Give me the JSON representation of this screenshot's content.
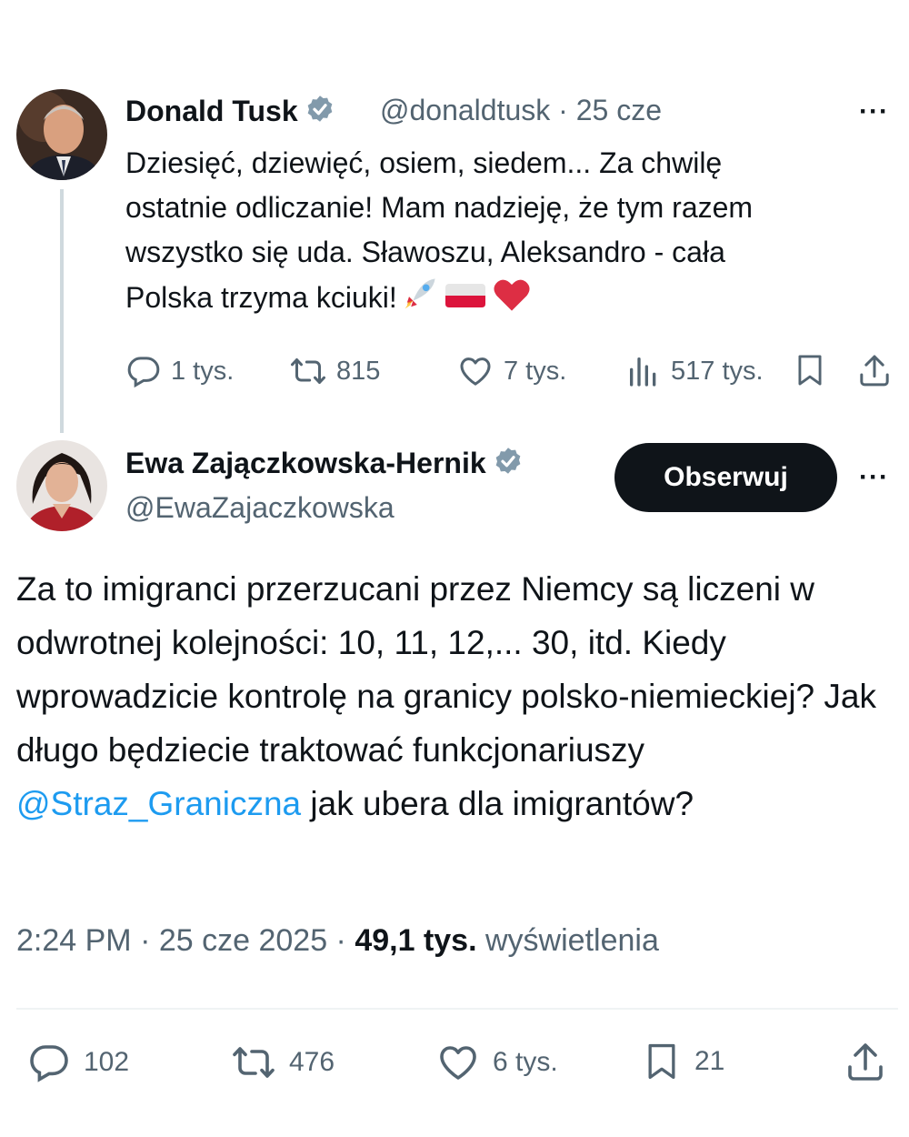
{
  "reply_to": {
    "author_name": "Donald Tusk",
    "handle": "@donaldtusk",
    "separator": " · ",
    "date": "25 cze",
    "text_lines": [
      "Dziesięć, dziewięć, osiem, siedem... Za chwilę",
      "ostatnie odliczanie! Mam nadzieję, że tym razem",
      "wszystko się uda. Sławoszu, Aleksandro - cała",
      "Polska trzyma kciuki!"
    ],
    "emojis": [
      "rocket-emoji",
      "poland-flag-emoji",
      "red-heart-emoji"
    ],
    "stats": {
      "replies": "1 tys.",
      "reposts": "815",
      "likes": "7 tys.",
      "views": "517 tys."
    },
    "more_label": "···"
  },
  "main_tweet": {
    "author_name": "Ewa Zajączkowska-Hernik",
    "handle": "@EwaZajaczkowska",
    "follow_label": "Obserwuj",
    "more_label": "···",
    "text_before_mention": "Za to imigranci przerzucani przez Niemcy są liczeni w odwrotnej kolejności: 10, 11, 12,... 30, itd. Kiedy wprowadzicie kontrolę na granicy polsko-niemieckiej? Jak długo będziecie traktować funkcjonariuszy ",
    "mention": "@Straz_Graniczna",
    "text_after_mention": " jak ubera dla imigrantów?",
    "time": "2:24 PM",
    "separator": " · ",
    "date": "25 cze 2025",
    "views_count": "49,1 tys.",
    "views_label": "wyświetlenia",
    "stats": {
      "replies": "102",
      "reposts": "476",
      "likes": "6 tys.",
      "bookmarks": "21"
    }
  },
  "colors": {
    "text": "#0f1419",
    "muted": "#536471",
    "link": "#1d9bf0",
    "verified": "#829aab",
    "button": "#0f1419"
  }
}
